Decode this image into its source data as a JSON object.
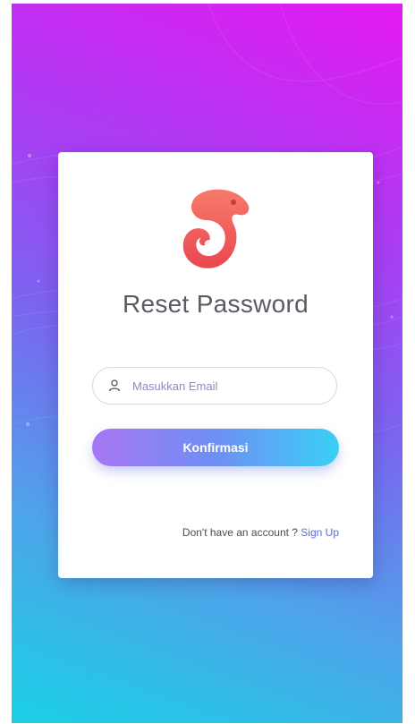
{
  "page": {
    "title": "Reset Password"
  },
  "form": {
    "email_placeholder": "Masukkan Email",
    "email_value": "",
    "confirm_label": "Konfirmasi"
  },
  "footer": {
    "prompt": "Don't have an account ? ",
    "signup_label": "Sign Up"
  },
  "icons": {
    "logo": "chameleon-logo-icon",
    "email": "user-icon"
  },
  "colors": {
    "background_top": "#e419f2",
    "background_bottom": "#19d0e6",
    "button_start": "#a876f4",
    "button_end": "#3ad0f6",
    "logo": "#f0605a",
    "link": "#5a6bd8"
  }
}
